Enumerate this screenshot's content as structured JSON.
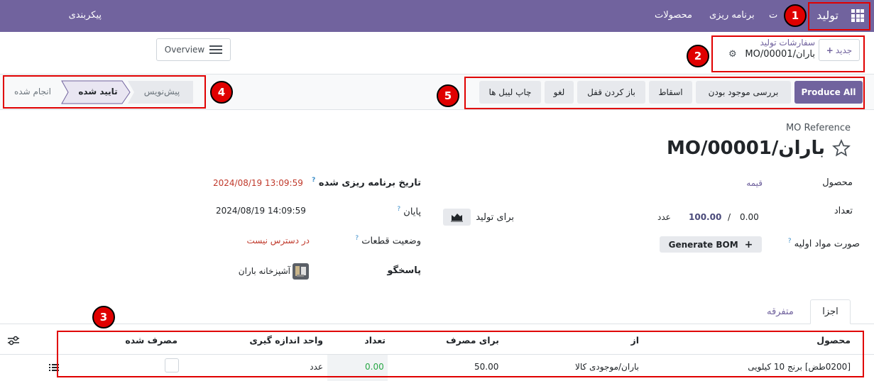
{
  "topbar": {
    "app_name": "تولید",
    "nav": [
      "پیکربندی",
      "محصولات",
      "برنامه ریزی",
      "ت"
    ]
  },
  "breadcrumb": {
    "new_label": "جدید",
    "parent": "سفارشات تولید",
    "current": "باران/MO/00001",
    "overview_label": "Overview"
  },
  "stages": {
    "draft": "پیش‌نویس",
    "confirmed": "تایید شده",
    "done": "انجام شده"
  },
  "actions": {
    "produce_all": "Produce All",
    "check_availability": "بررسی موجود بودن",
    "scrap": "اسقاط",
    "unlock": "باز کردن قفل",
    "cancel": "لغو",
    "print_labels": "چاپ لیبل ها"
  },
  "form": {
    "ref_label": "MO Reference",
    "ref_value": "باران/MO/00001",
    "product_label": "محصول",
    "product_value": "قیمه",
    "qty_label": "تعداد",
    "qty_produced": "0.00",
    "qty_sep": "/",
    "qty_total": "100.00",
    "qty_uom": "عدد",
    "to_produce": "برای تولید",
    "bom_label": "صورت مواد اولیه",
    "generate_bom": "Generate BOM",
    "scheduled_label": "تاریخ برنامه ریزی شده",
    "scheduled_value": "2024/08/19 13:09:59",
    "end_label": "پایان",
    "end_value": "2024/08/19 14:09:59",
    "components_label": "وضعیت قطعات",
    "components_value": "در دسترس نیست",
    "responsible_label": "پاسخگو",
    "responsible_value": "آشپزخانه باران"
  },
  "tabs": {
    "components": "اجزا",
    "misc": "متفرقه"
  },
  "table": {
    "headers": [
      "محصول",
      "از",
      "برای مصرف",
      "تعداد",
      "واحد اندازه گیری",
      "مصرف شده"
    ],
    "row": {
      "product": "[0200طض] برنج 10 کیلویی",
      "from": "باران/موجودی کالا",
      "to_consume": "50.00",
      "quantity": "0.00",
      "uom": "عدد"
    }
  },
  "annotations": [
    "1",
    "2",
    "3",
    "4",
    "5"
  ],
  "colors": {
    "brand": "#71639e",
    "annotation": "#e00000",
    "date_red": "#c0392b",
    "qty_green": "#28a745"
  }
}
